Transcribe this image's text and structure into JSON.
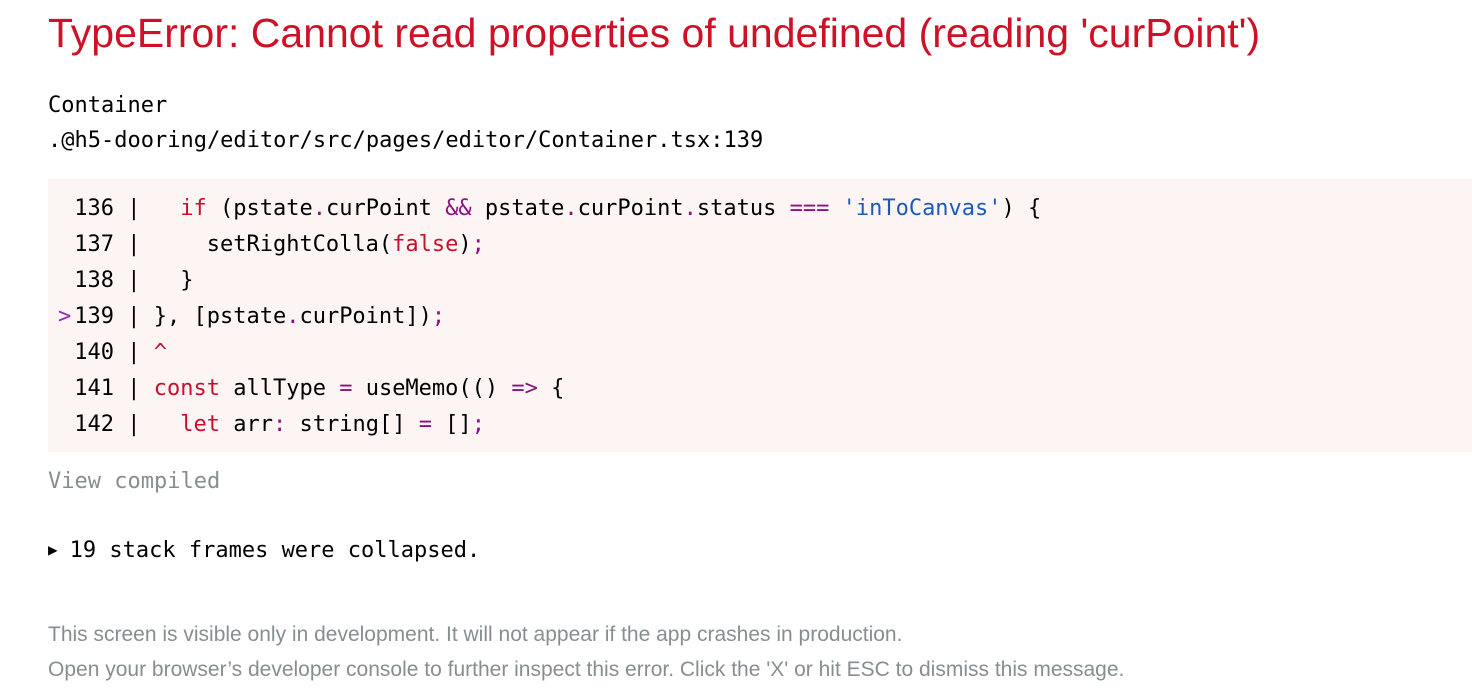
{
  "error": {
    "title": "TypeError: Cannot read properties of undefined (reading 'curPoint')",
    "component": "Container",
    "file_path": ".@h5-dooring/editor/src/pages/editor/Container.tsx:139"
  },
  "code_frame": {
    "lines": [
      {
        "marker": "",
        "number": "136",
        "text": "   if (pstate.curPoint && pstate.curPoint.status === 'inToCanvas') {"
      },
      {
        "marker": "",
        "number": "137",
        "text": "     setRightColla(false);"
      },
      {
        "marker": "",
        "number": "138",
        "text": "   }"
      },
      {
        "marker": ">",
        "number": "139",
        "text": " }, [pstate.curPoint]);"
      },
      {
        "marker": "",
        "number": "140",
        "text": " ^"
      },
      {
        "marker": "",
        "number": "141",
        "text": " const allType = useMemo(() => {"
      },
      {
        "marker": "",
        "number": "142",
        "text": "   let arr: string[] = [];"
      }
    ],
    "separator": "|"
  },
  "view_compiled_label": "View compiled",
  "stack_frames": {
    "toggle_icon": "▶",
    "label": "19 stack frames were collapsed."
  },
  "footer": {
    "line1": "This screen is visible only in development. It will not appear if the app crashes in production.",
    "line2": "Open your browser’s developer console to further inspect this error.  Click the 'X' or hit ESC to dismiss this message."
  },
  "colors": {
    "error_red": "#ce1126",
    "code_bg": "#fdf4f4",
    "muted_gray": "#878e91",
    "keyword_red": "#c8102e",
    "operator_purple": "#881280",
    "string_blue": "#1a5ab8"
  }
}
